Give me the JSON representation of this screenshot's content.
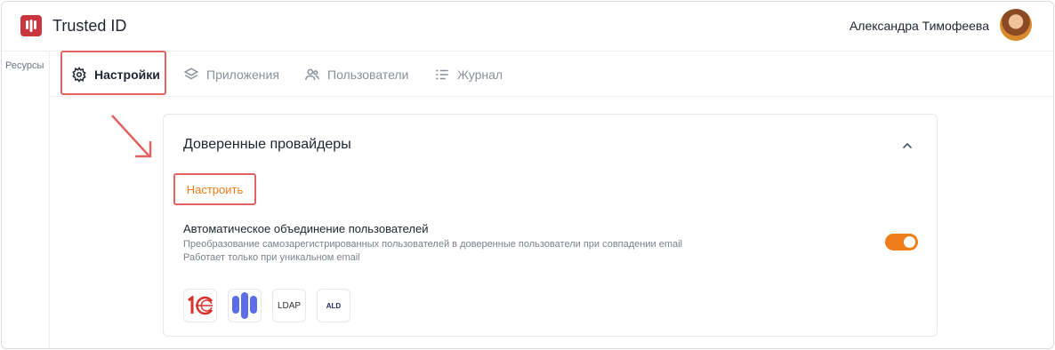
{
  "header": {
    "app_title": "Trusted ID",
    "user_name": "Александра Тимофеева"
  },
  "left_rail": {
    "label": "Ресурсы"
  },
  "tabs": [
    {
      "label": "Настройки",
      "icon": "gear-icon",
      "active": true
    },
    {
      "label": "Приложения",
      "icon": "layers-icon",
      "active": false
    },
    {
      "label": "Пользователи",
      "icon": "users-icon",
      "active": false
    },
    {
      "label": "Журнал",
      "icon": "list-icon",
      "active": false
    }
  ],
  "card": {
    "title": "Доверенные провайдеры",
    "configure_label": "Настроить",
    "setting": {
      "title": "Автоматическое объединение пользователей",
      "description_line1": "Преобразование самозарегистрированных пользователей в доверенные пользователи при совпадении email",
      "description_line2": "Работает только при уникальном email",
      "enabled": true
    },
    "providers": [
      {
        "name": "1С",
        "icon": "1c-logo-icon"
      },
      {
        "name": "Trusted",
        "icon": "trusted-logo-icon"
      },
      {
        "name": "LDAP",
        "icon": "ldap-icon"
      },
      {
        "name": "ALD",
        "icon": "ald-pro-logo-icon"
      }
    ]
  },
  "colors": {
    "accent": "#ef7d1a",
    "highlight": "#e06262",
    "brand": "#c9363e",
    "provider_blue": "#5b6ee8"
  }
}
